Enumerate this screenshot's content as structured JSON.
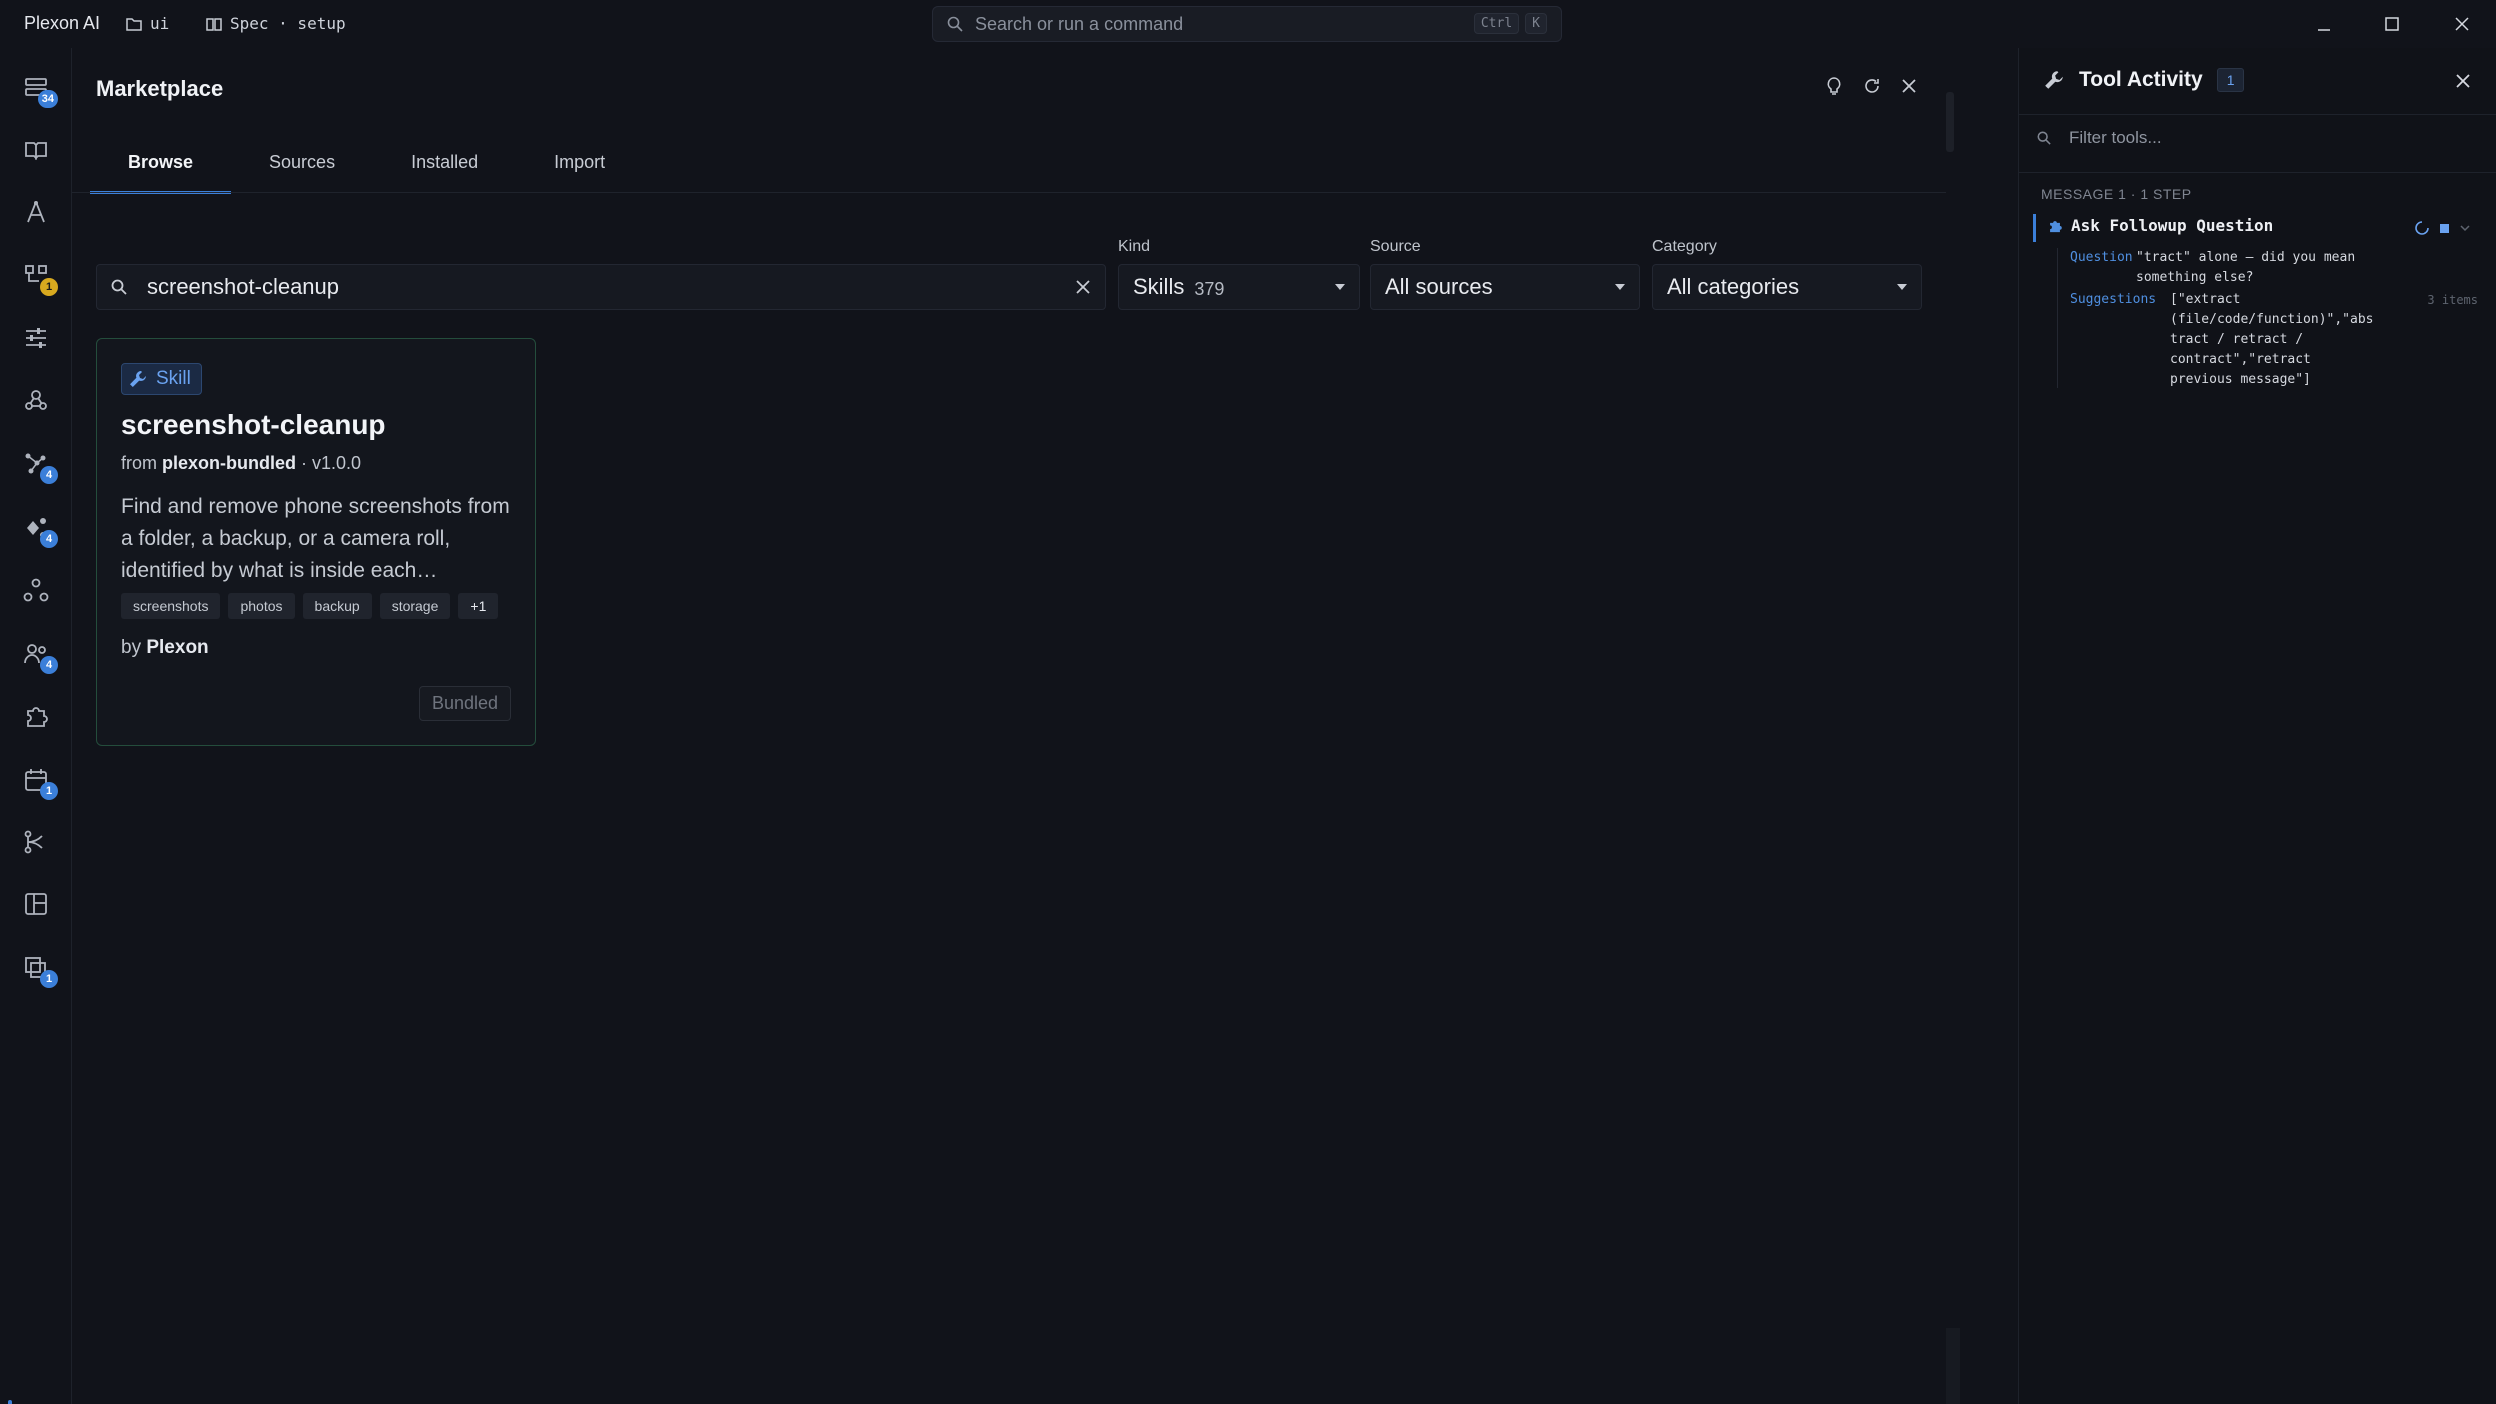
{
  "titlebar": {
    "app_name": "Plexon AI",
    "workspace": "ui",
    "spec": "Spec · setup",
    "command_placeholder": "Search or run a command",
    "shortcut_keys": [
      "Ctrl",
      "K"
    ]
  },
  "rail": {
    "items": [
      {
        "name": "sessions",
        "badge": "34",
        "badge_color": "#3b7fd9"
      },
      {
        "name": "specs",
        "badge": ""
      },
      {
        "name": "agents",
        "badge": ""
      },
      {
        "name": "tasks",
        "badge": "1",
        "badge_color": "#d8a91f"
      },
      {
        "name": "settings",
        "badge": ""
      },
      {
        "name": "hooks",
        "badge": ""
      },
      {
        "name": "graph",
        "badge": "4",
        "badge_color": "#3b7fd9"
      },
      {
        "name": "flows",
        "badge": "4",
        "badge_color": "#3b7fd9"
      },
      {
        "name": "nodes",
        "badge": ""
      },
      {
        "name": "team",
        "badge": "4",
        "badge_color": "#3b7fd9"
      },
      {
        "name": "extensions",
        "badge": ""
      },
      {
        "name": "schedule",
        "badge": "1",
        "badge_color": "#3b7fd9"
      },
      {
        "name": "branches",
        "badge": ""
      },
      {
        "name": "layout",
        "badge": ""
      },
      {
        "name": "history",
        "badge": "1",
        "badge_color": "#3b7fd9"
      },
      {
        "name": "marketplace",
        "badge": ""
      }
    ]
  },
  "marketplace": {
    "title": "Marketplace",
    "tabs": [
      {
        "label": "Browse",
        "active": true
      },
      {
        "label": "Sources",
        "active": false
      },
      {
        "label": "Installed",
        "active": false
      },
      {
        "label": "Import",
        "active": false
      }
    ],
    "search": {
      "value": "screenshot-cleanup"
    },
    "filters": {
      "kind": {
        "label": "Kind",
        "value": "Skills",
        "count": "379"
      },
      "source": {
        "label": "Source",
        "value": "All sources"
      },
      "category": {
        "label": "Category",
        "value": "All categories"
      }
    },
    "results": [
      {
        "kind": "Skill",
        "name": "screenshot-cleanup",
        "from_label": "from",
        "source": "plexon-bundled",
        "version": "· v1.0.0",
        "description": "Find and remove phone screenshots from a folder, a backup, or a camera roll, identified by what is inside each…",
        "tags": [
          "screenshots",
          "photos",
          "backup",
          "storage",
          "+1"
        ],
        "by_label": "by",
        "author": "Plexon",
        "status": "Bundled"
      }
    ]
  },
  "tool_activity": {
    "title": "Tool Activity",
    "count": "1",
    "filter_placeholder": "Filter tools...",
    "message_label": "MESSAGE 1 · 1 STEP",
    "step": {
      "name": "Ask Followup Question",
      "question_key": "Question",
      "question_value": "\"tract\" alone — did you mean\nsomething else?",
      "suggestions_key": "Suggestions",
      "suggestions_value": "[\"extract\n(file/code/function)\",\"abs\ntract / retract /\ncontract\",\"retract\nprevious message\"]",
      "suggestions_count": "3 items"
    }
  },
  "colors": {
    "accent": "#3b7fd9",
    "card_border": "#244d3c",
    "background": "#11131a"
  }
}
